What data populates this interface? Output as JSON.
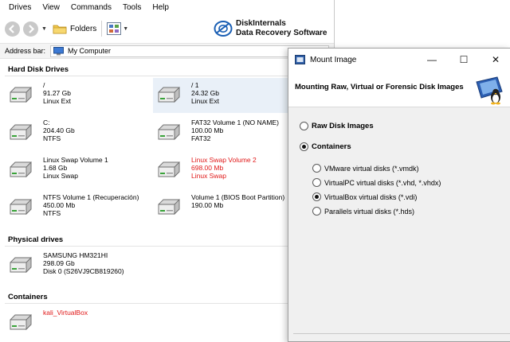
{
  "menu": [
    "Drives",
    "View",
    "Commands",
    "Tools",
    "Help"
  ],
  "toolbar": {
    "folders_label": "Folders"
  },
  "brand": {
    "line1": "DiskInternals",
    "line2": "Data Recovery Software"
  },
  "address": {
    "label": "Address bar:",
    "value": "My Computer"
  },
  "sections": {
    "hdd_title": "Hard Disk Drives",
    "physical_title": "Physical drives",
    "containers_title": "Containers"
  },
  "hdd_items": [
    {
      "name": "/",
      "size": "91.27 Gb",
      "fs": "Linux Ext",
      "red": false
    },
    {
      "name": "/ 1",
      "size": "24.32 Gb",
      "fs": "Linux Ext",
      "red": false
    },
    {
      "name": "C:",
      "size": "204.40 Gb",
      "fs": "NTFS",
      "red": false
    },
    {
      "name": "FAT32 Volume 1 (NO NAME)",
      "size": "100.00 Mb",
      "fs": "FAT32",
      "red": false
    },
    {
      "name": "Linux Swap Volume 1",
      "size": "1.68 Gb",
      "fs": "Linux Swap",
      "red": false
    },
    {
      "name": "Linux Swap Volume 2",
      "size": "698.00 Mb",
      "fs": "Linux Swap",
      "red": true
    },
    {
      "name": "NTFS Volume 1 (Recuperación)",
      "size": "450.00 Mb",
      "fs": "NTFS",
      "red": false
    },
    {
      "name": "Volume 1 (BIOS Boot Partition)",
      "size": "190.00 Mb",
      "fs": "",
      "red": false
    }
  ],
  "physical_items": [
    {
      "name": "SAMSUNG HM321HI",
      "size": "298.09 Gb",
      "fs": "Disk 0 (S26VJ9CB819260)"
    }
  ],
  "container_items": [
    {
      "name": "kali_VirtualBox"
    }
  ],
  "dialog": {
    "title": "Mount Image",
    "header": "Mounting Raw, Virtual or Forensic Disk Images",
    "minimize": "—",
    "maximize": "☐",
    "close": "✕",
    "options": {
      "raw": "Raw Disk Images",
      "containers": "Containers",
      "vmware": "VMware virtual disks (*.vmdk)",
      "virtualpc": "VirtualPC virtual disks (*.vhd, *.vhdx)",
      "virtualbox": "VirtualBox virtual disks (*.vdi)",
      "parallels": "Parallels virtual disks (*.hds)"
    },
    "selected_main": "containers",
    "selected_sub": "virtualbox"
  },
  "colors": {
    "selection": "#e9f0f8",
    "warning_text": "#e01818",
    "accent": "#1a5fb4"
  }
}
